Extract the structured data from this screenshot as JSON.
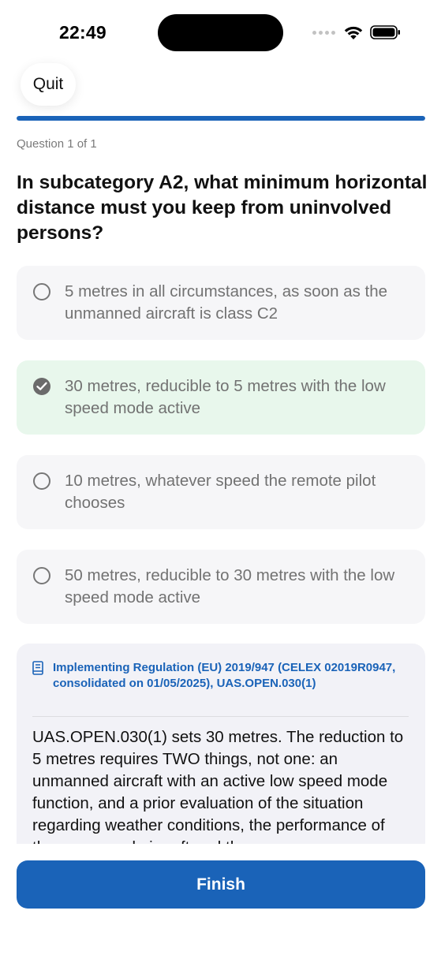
{
  "status_bar": {
    "time": "22:49"
  },
  "header": {
    "quit_label": "Quit",
    "progress_fraction": 1.0
  },
  "question": {
    "counter": "Question 1 of 1",
    "text": "In subcategory A2, what minimum horizontal distance must you keep from uninvolved persons?"
  },
  "options": [
    {
      "label": "5 metres in all circumstances, as soon as the unmanned aircraft is class C2",
      "selected": false
    },
    {
      "label": "30 metres, reducible to 5 metres with the low speed mode active",
      "selected": true
    },
    {
      "label": "10 metres, whatever speed the remote pilot chooses",
      "selected": false
    },
    {
      "label": "50 metres, reducible to 30 metres with the low speed mode active",
      "selected": false
    }
  ],
  "explanation": {
    "source": "Implementing Regulation (EU) 2019/947 (CELEX 02019R0947, consolidated on 01/05/2025), UAS.OPEN.030(1)",
    "text": "UAS.OPEN.030(1) sets 30 metres. The reduction to 5 metres requires TWO things, not one: an unmanned aircraft with an active low speed mode function, and a prior evaluation of the situation regarding weather conditions, the performance of the unmanned aircraft and the"
  },
  "footer": {
    "finish_label": "Finish"
  },
  "colors": {
    "accent": "#1a63b8",
    "selected_bg": "#e8f7ec",
    "option_bg": "#f6f6f8",
    "explanation_bg": "#f2f2f7"
  }
}
